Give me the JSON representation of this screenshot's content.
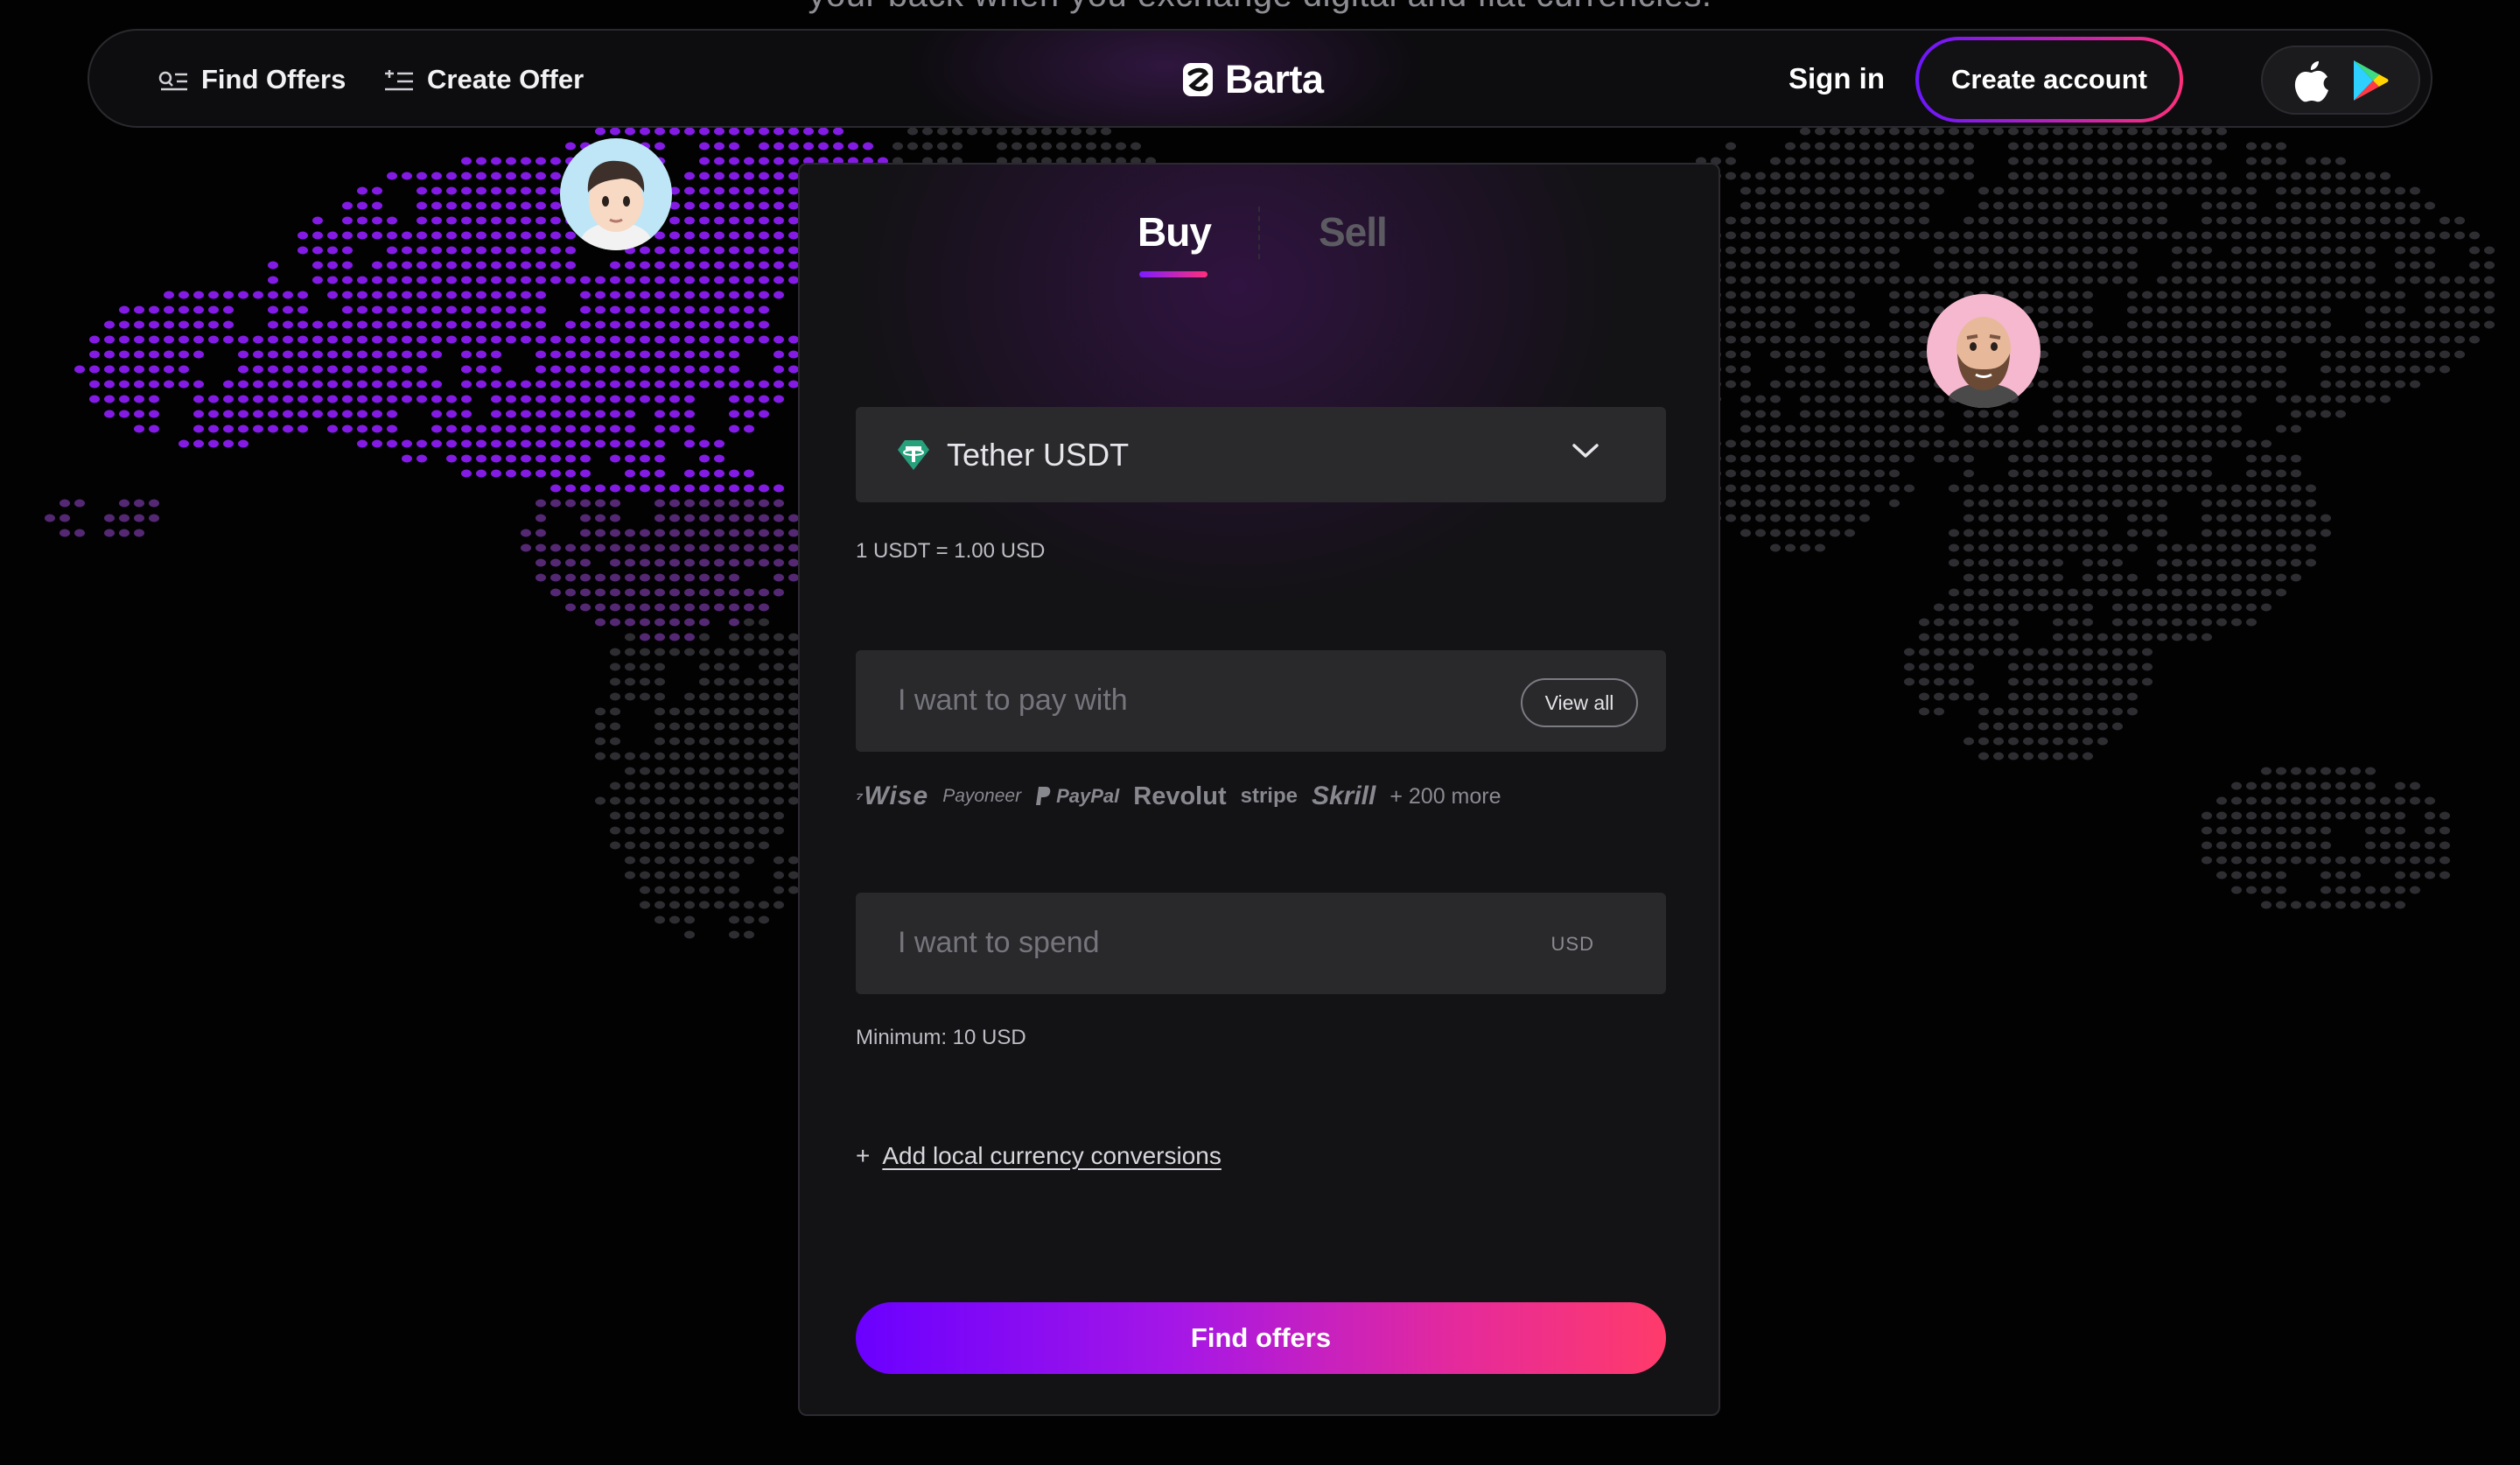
{
  "hero": {
    "subtitle_cut": "your back when you exchange digital and fiat currencies."
  },
  "nav": {
    "find_offers": "Find Offers",
    "create_offer": "Create Offer",
    "brand": "Barta",
    "sign_in": "Sign in",
    "create_account": "Create account",
    "store_icons": [
      "apple-icon",
      "google-play-icon"
    ]
  },
  "form": {
    "tabs": [
      {
        "label": "Buy",
        "active": true
      },
      {
        "label": "Sell",
        "active": false
      }
    ],
    "asset": {
      "label": "Tether USDT",
      "icon": "tether-icon"
    },
    "rate_text": "1 USDT = 1.00 USD",
    "pay_with": {
      "placeholder": "I want to pay with",
      "view_all": "View all"
    },
    "providers": [
      "Wise",
      "Payoneer",
      "PayPal",
      "Revolut",
      "stripe",
      "Skrill"
    ],
    "providers_more": "+ 200 more",
    "spend": {
      "placeholder": "I want to spend",
      "currency": "USD"
    },
    "minimum_text": "Minimum: 10 USD",
    "add_conversions": {
      "plus": "+",
      "label": "Add local currency conversions"
    },
    "submit_label": "Find offers"
  },
  "colors": {
    "accent_start": "#6a00ff",
    "accent_end": "#ff3b6a",
    "map_active": "#8a1cf0",
    "map_inactive": "#3a3a3e",
    "tether_green": "#26a17b"
  }
}
